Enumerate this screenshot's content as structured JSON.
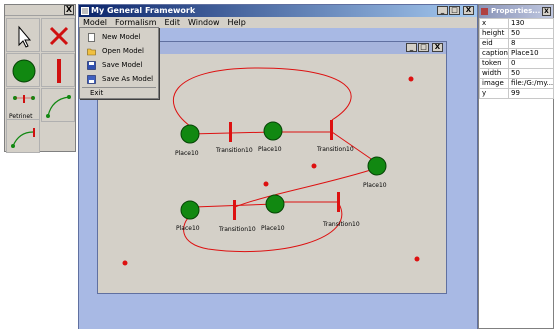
{
  "palette": {
    "close_label": "X",
    "petrinet_label": "Petrinet"
  },
  "main_window": {
    "title": "My General Framework",
    "minimize": "_",
    "maximize": "□",
    "close": "X"
  },
  "menubar": {
    "items": [
      "Model",
      "Formalism",
      "Edit",
      "Window",
      "Help"
    ]
  },
  "model_menu": {
    "items": [
      {
        "label": "New Model",
        "icon": "new-model-icon"
      },
      {
        "label": "Open Model",
        "icon": "open-folder-icon"
      },
      {
        "label": "Save Model",
        "icon": "save-disk-icon"
      },
      {
        "label": "Save As Model",
        "icon": "save-as-icon"
      },
      {
        "label": "Exit",
        "icon": ""
      }
    ]
  },
  "child_window": {
    "minimize": "_",
    "maximize": "□",
    "close": "X"
  },
  "canvas": {
    "places": [
      "Place10",
      "Place10",
      "Place10",
      "Place10",
      "Place10"
    ],
    "transitions": [
      "Transition10",
      "Transition10",
      "Transition10",
      "Transition10"
    ]
  },
  "properties": {
    "title": "Properties...",
    "close": "X",
    "rows": [
      {
        "key": "x",
        "value": "130"
      },
      {
        "key": "height",
        "value": "50"
      },
      {
        "key": "eid",
        "value": "8"
      },
      {
        "key": "caption",
        "value": "Place10"
      },
      {
        "key": "token",
        "value": "0"
      },
      {
        "key": "width",
        "value": "50"
      },
      {
        "key": "image",
        "value": "file:/G:/my..."
      },
      {
        "key": "y",
        "value": "99"
      }
    ]
  },
  "colors": {
    "place_fill": "#118811",
    "arc": "#dd1111",
    "title_bar": "#0a246a",
    "workspace": "#a8b9e4",
    "canvas_bg": "#d4d0c8"
  }
}
